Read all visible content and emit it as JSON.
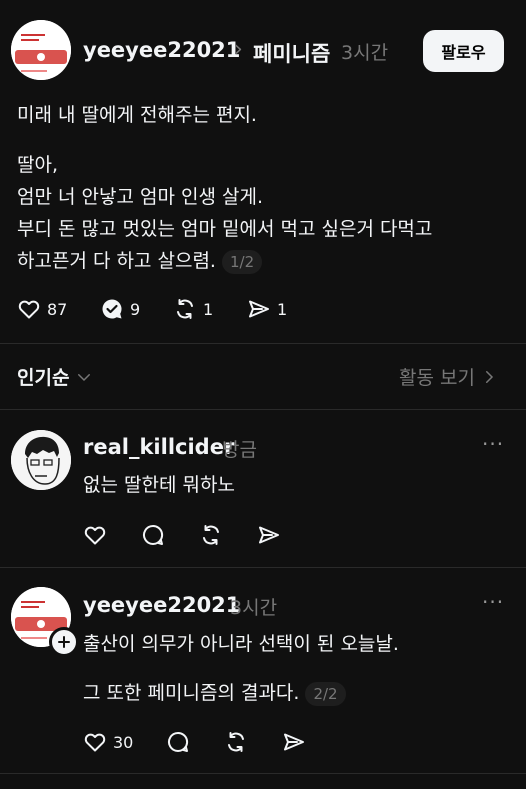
{
  "post": {
    "username": "yeeyee22021",
    "breadcrumb_arrow": "›",
    "topic": "페미니즘",
    "time": "3시간",
    "follow_label": "팔로우",
    "lines": [
      "미래 내 딸에게 전해주는 편지.",
      "딸아,",
      "엄만 너 안낳고 엄마 인생 살게.",
      "부디 돈 많고 멋있는 엄마 밑에서 먹고 싶은거 다먹고",
      "하고픈거 다 하고 살으렴."
    ],
    "pager": "1/2",
    "likes": "87",
    "replies": "9",
    "reposts": "1",
    "shares": "1"
  },
  "sort": {
    "label": "인기순",
    "activity_label": "활동 보기"
  },
  "comments": [
    {
      "username": "real_killcider",
      "time": "방금",
      "text": "없는 딸한테 뭐하노",
      "more": "···"
    },
    {
      "username": "yeeyee22021",
      "time": "3시간",
      "line1": "출산이 의무가 아니라 선택이 된 오늘날.",
      "line2": "그 또한 페미니즘의 결과다.",
      "pager": "2/2",
      "likes": "30",
      "more": "···"
    }
  ],
  "colors": {
    "background": "#101010",
    "text": "#f3f5f7",
    "muted": "#777777",
    "divider": "#2a2a2a",
    "follow_button_bg": "#f3f5f7"
  },
  "icons": [
    "heart-icon",
    "comment-check-icon",
    "repost-icon",
    "share-icon",
    "chevron-down-icon",
    "chevron-right-icon",
    "more-icon",
    "plus-icon"
  ]
}
